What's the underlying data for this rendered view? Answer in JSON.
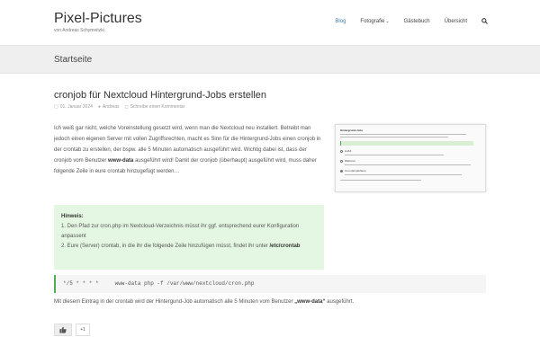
{
  "site": {
    "title": "Pixel-Pictures",
    "tagline": "von Andreas Schymeitzki"
  },
  "nav": {
    "items": [
      {
        "label": "Blog",
        "active": true
      },
      {
        "label": "Fotografie",
        "dropdown": true
      },
      {
        "label": "Gästebuch"
      },
      {
        "label": "Übersicht"
      }
    ],
    "search_icon": "search-icon"
  },
  "page": {
    "title": "Startseite"
  },
  "post": {
    "title": "cronjob für Nextcloud Hintergrund-Jobs erstellen",
    "date": "01. Januar 2024",
    "author": "Andreas",
    "comment_link": "Schreibe einen Kommentar",
    "para_1": "Ich weiß gar nicht, welche Voreinstellung gesetzt wird, wenn man die Nextcloud neu installiert. Betreibt man jedoch einen eigenen Server mit vollen Zugriffsrechten, macht es Sinn für die Hintergrund-Jobs einen cronjob in der crontab zu erstellen, der bspw. alle 5 Minuten automatisch ausgeführt wird. Wichtig dabei ist, dass der cronjob vom Benutzer",
    "para_bold": "www-data",
    "para_2": "ausgeführt wird! Damit der cronjob (überhaupt) ausgeführt wird, muss daher folgende Zeile in eure crontab hinzugefügt werden…",
    "screenshot": {
      "title": "Hintergrund-Jobs",
      "options": [
        "AJAX",
        "Webcron",
        "Cron (Empfohlen)"
      ]
    },
    "hint": {
      "title": "Hinweis:",
      "line_1": "1. Den Pfad zur cron.php im Nextcloud-Verzeichnis müsst ihr ggf. entsprechend eurer Konfiguration anpassent",
      "line_2": "2. Eure (Server) crontab, in die ihr die folgende Zeile hinzufügen müsst, findet ihr unter",
      "path": "/etc/crontab"
    },
    "code": "*/5 * * * *     www-data php -f /var/www/nextcloud/cron.php",
    "note_pre": "Mit diesem Eintrag in der crontab wird der Hintergund-Job automatisch alle 5 Minuten vom Benutzer",
    "note_bold": "„www-data“",
    "note_post": "ausgeführt.",
    "like_count": "+1"
  },
  "colors": {
    "accent": "#3b7fb0",
    "hint_bg": "#e4f7e2",
    "code_border": "#4caf50"
  }
}
